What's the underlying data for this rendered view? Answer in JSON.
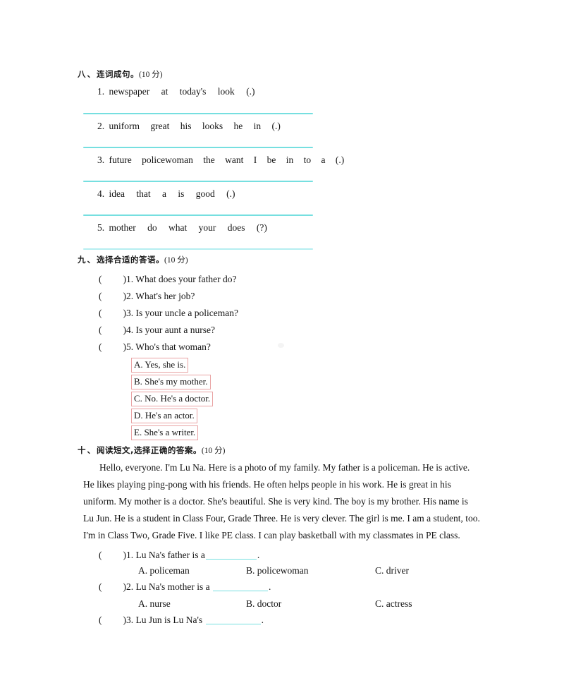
{
  "page": {
    "rule_color": "#76dfe0",
    "rule_color_pale": "#b5eef0",
    "answer_box_border": "#e9a3a4",
    "text_color": "#141414"
  },
  "section8": {
    "number": "八、",
    "title": "连词成句。",
    "score": "(10 分)",
    "items": [
      {
        "num": "1.",
        "words": [
          "newspaper",
          "at",
          "today's",
          "look",
          "(.)"
        ]
      },
      {
        "num": "2.",
        "words": [
          "uniform",
          "great",
          "his",
          "looks",
          "he",
          "in",
          "(.)"
        ]
      },
      {
        "num": "3.",
        "words": [
          "future",
          "policewoman",
          "the",
          "want",
          "I",
          "be",
          "in",
          "to",
          "a",
          "(.)"
        ]
      },
      {
        "num": "4.",
        "words": [
          "idea",
          "that",
          "a",
          "is",
          "good",
          "(.)"
        ]
      },
      {
        "num": "5.",
        "words": [
          "mother",
          "do",
          "what",
          "your",
          "does",
          "(?)"
        ]
      }
    ]
  },
  "section9": {
    "number": "九、",
    "title": "选择合适的答语。",
    "score": "(10 分)",
    "questions": [
      {
        "label": ")1.",
        "text": "What does your father do?"
      },
      {
        "label": ")2.",
        "text": "What's her job?"
      },
      {
        "label": ")3.",
        "text": "Is your uncle a policeman?"
      },
      {
        "label": ")4.",
        "text": "Is your aunt a nurse?"
      },
      {
        "label": ")5.",
        "text": "Who's that woman?"
      }
    ],
    "answers": [
      {
        "text": "A. Yes, she is."
      },
      {
        "text": "B. She's my mother."
      },
      {
        "text": "C. No. He's a doctor."
      },
      {
        "text": "D. He's an actor."
      },
      {
        "text": "E. She's a writer."
      }
    ]
  },
  "section10": {
    "number": "十、",
    "title": "阅读短文,选择正确的答案。",
    "score": "(10 分)",
    "passage_lines": [
      "Hello, everyone. I'm Lu Na. Here is a photo of my family. My father is a policeman. He is active.",
      "He likes playing ping-pong with his friends. He often helps people in his work. He is great in his",
      "uniform. My mother is a doctor. She's beautiful. She is very kind. The boy is my brother. His name is",
      "Lu Jun. He is a student in Class Four, Grade Three. He is very clever. The girl is me. I am a student, too.",
      "I'm in Class Two, Grade Five. I like PE class. I can play basketball with my classmates in PE class."
    ],
    "questions": [
      {
        "label": ")1.",
        "stem_before": "Lu Na's father is a",
        "stem_after": ".",
        "options": {
          "a": "A. policeman",
          "b": "B. policewoman",
          "c": "C. driver"
        }
      },
      {
        "label": ")2.",
        "stem_before": "Lu Na's mother is a",
        "stem_after": ".",
        "options": {
          "a": "A. nurse",
          "b": "B. doctor",
          "c": "C. actress"
        }
      },
      {
        "label": ")3.",
        "stem_before": "Lu Jun is Lu Na's",
        "stem_after": ".",
        "options": {
          "a": "",
          "b": "",
          "c": ""
        }
      }
    ]
  }
}
